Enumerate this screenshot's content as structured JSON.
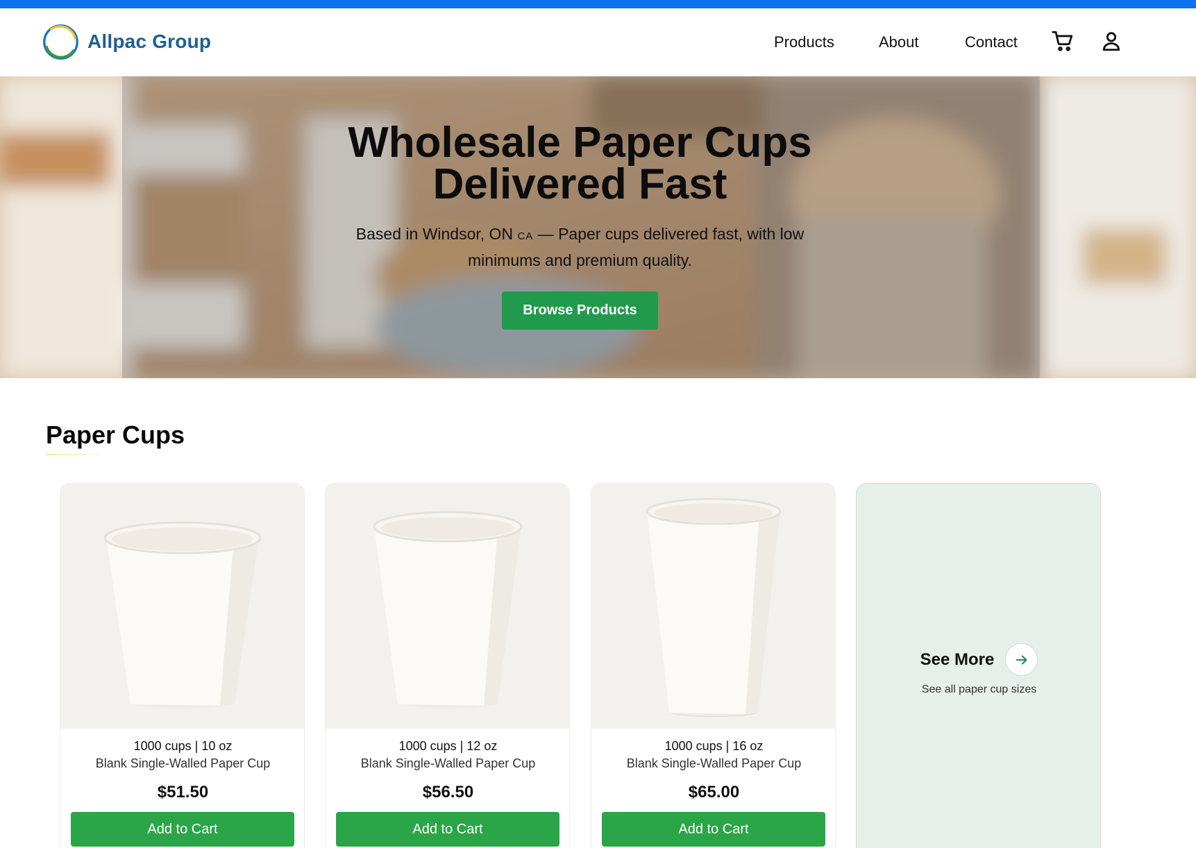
{
  "brand": {
    "name": "Allpac Group",
    "logo_icon": "ring-logo-icon"
  },
  "nav": {
    "links": [
      {
        "label": "Products"
      },
      {
        "label": "About"
      },
      {
        "label": "Contact"
      }
    ],
    "cart_icon": "cart-icon",
    "account_icon": "user-icon"
  },
  "hero": {
    "title_line1": "Wholesale Paper Cups",
    "title_line2": "Delivered Fast",
    "subtitle_pre": "Based in Windsor, ON",
    "subtitle_flag": "CA",
    "subtitle_post": "— Paper cups delivered fast, with low minimums and premium quality.",
    "button_label": "Browse Products"
  },
  "section": {
    "title": "Paper Cups"
  },
  "products": [
    {
      "meta": "1000 cups | 10 oz",
      "name": "Blank Single-Walled Paper Cup",
      "price": "$51.50",
      "button": "Add to Cart"
    },
    {
      "meta": "1000 cups | 12 oz",
      "name": "Blank Single-Walled Paper Cup",
      "price": "$56.50",
      "button": "Add to Cart"
    },
    {
      "meta": "1000 cups | 16 oz",
      "name": "Blank Single-Walled Paper Cup",
      "price": "$65.00",
      "button": "Add to Cart"
    }
  ],
  "see_more": {
    "title": "See More",
    "subtitle": "See all paper cup sizes",
    "icon": "arrow-right-icon"
  },
  "colors": {
    "topbar": "#0b73ee",
    "primary_green": "#229a4d",
    "brand_blue": "#1d5f95",
    "more_card_bg": "#e6efe9"
  }
}
